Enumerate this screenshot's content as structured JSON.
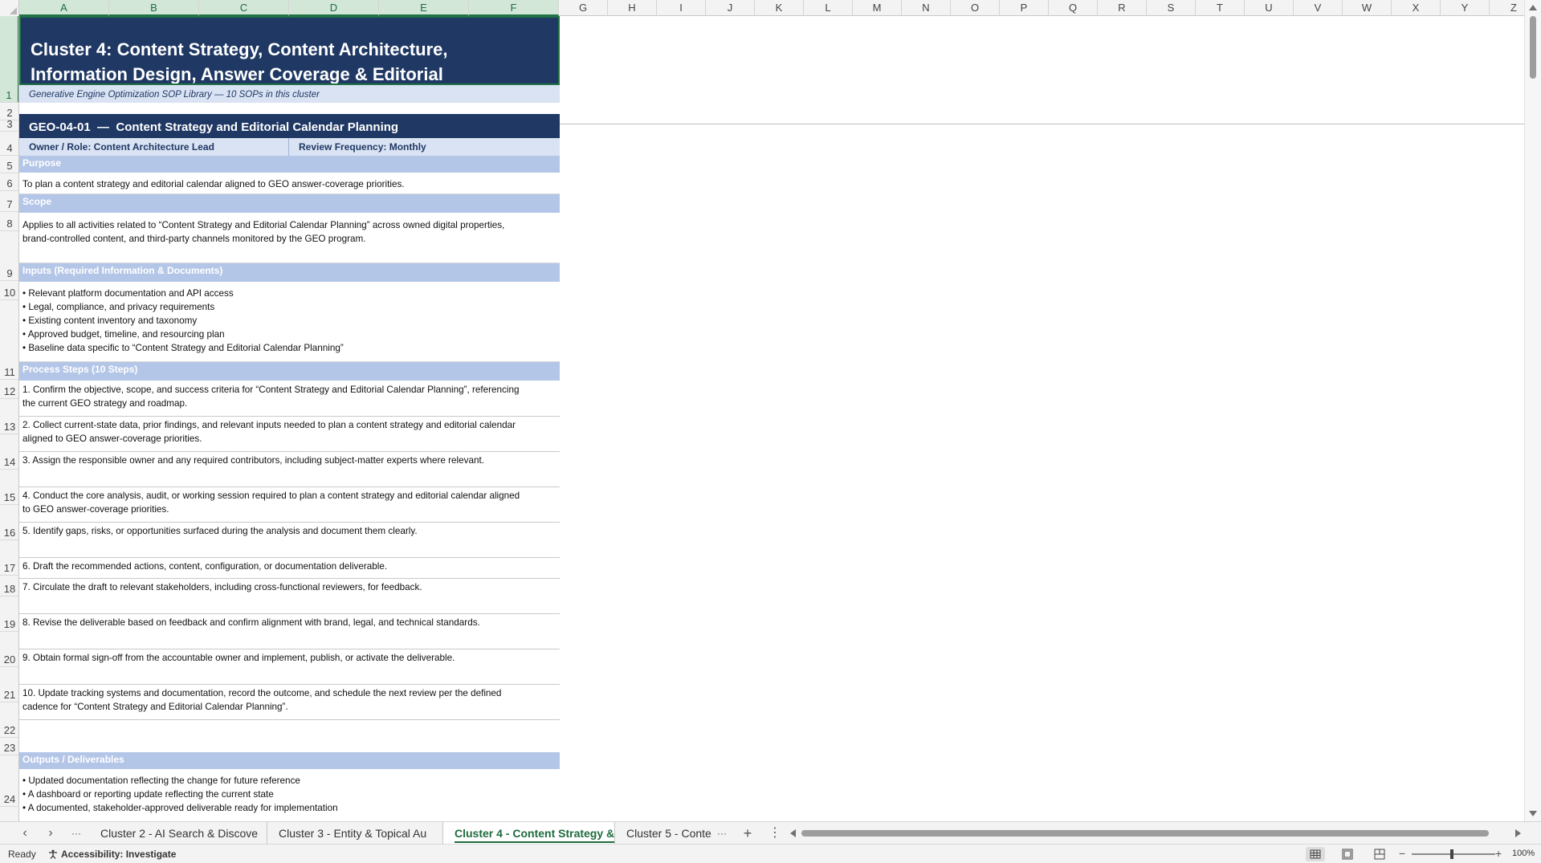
{
  "columns": [
    "A",
    "B",
    "C",
    "D",
    "E",
    "F",
    "G",
    "H",
    "I",
    "J",
    "K",
    "L",
    "M",
    "N",
    "O",
    "P",
    "Q",
    "R",
    "S",
    "T",
    "U",
    "V",
    "W",
    "X",
    "Y",
    "Z"
  ],
  "rows": [
    "1",
    "2",
    "3",
    "4",
    "5",
    "6",
    "7",
    "8",
    "9",
    "10",
    "11",
    "12",
    "13",
    "14",
    "15",
    "16",
    "17",
    "18",
    "19",
    "20",
    "21",
    "22",
    "23",
    "24"
  ],
  "sheet": {
    "title": "Cluster 4: Content Strategy, Content Architecture, Information Design, Answer Coverage & Editorial Optimization Management",
    "subtitle": "Generative Engine Optimization SOP Library — 10 SOPs in this cluster",
    "sop": {
      "header": "GEO-04-01  —  Content Strategy and Editorial Calendar Planning",
      "owner": "Owner / Role: Content Architecture Lead",
      "frequency": "Review Frequency: Monthly",
      "purpose_label": "Purpose",
      "purpose_text": "To plan a content strategy and editorial calendar aligned to GEO answer-coverage priorities.",
      "scope_label": "Scope",
      "scope_text_1": "Applies to all activities related to “Content Strategy and Editorial Calendar Planning” across owned digital properties,",
      "scope_text_2": "brand-controlled content, and third-party channels monitored by the GEO program.",
      "inputs_label": "Inputs (Required Information & Documents)",
      "inputs": [
        "• Relevant platform documentation and API access",
        "• Legal, compliance, and privacy requirements",
        "• Existing content inventory and taxonomy",
        "• Approved budget, timeline, and resourcing plan",
        "• Baseline data specific to “Content Strategy and Editorial Calendar Planning”"
      ],
      "steps_label": "Process Steps (10 Steps)",
      "steps": [
        [
          "1. Confirm the objective, scope, and success criteria for “Content Strategy and Editorial Calendar Planning”, referencing",
          "the current GEO strategy and roadmap."
        ],
        [
          "2. Collect current-state data, prior findings, and relevant inputs needed to plan a content strategy and editorial calendar",
          "aligned to GEO answer-coverage priorities."
        ],
        [
          "3. Assign the responsible owner and any required contributors, including subject-matter experts where relevant.",
          ""
        ],
        [
          "4. Conduct the core analysis, audit, or working session required to plan a content strategy and editorial calendar aligned",
          "to GEO answer-coverage priorities."
        ],
        [
          "5. Identify gaps, risks, or opportunities surfaced during the analysis and document them clearly.",
          ""
        ],
        [
          "6. Draft the recommended actions, content, configuration, or documentation deliverable.",
          ""
        ],
        [
          "7. Circulate the draft to relevant stakeholders, including cross-functional reviewers, for feedback.",
          ""
        ],
        [
          "8. Revise the deliverable based on feedback and confirm alignment with brand, legal, and technical standards.",
          ""
        ],
        [
          "9. Obtain formal sign-off from the accountable owner and implement, publish, or activate the deliverable.",
          ""
        ],
        [
          "10. Update tracking systems and documentation, record the outcome, and schedule the next review per the defined",
          "cadence for “Content Strategy and Editorial Calendar Planning”."
        ]
      ],
      "outputs_label": "Outputs / Deliverables",
      "outputs": [
        "• Updated documentation reflecting the change for future reference",
        "• A dashboard or reporting update reflecting the current state",
        "• A documented, stakeholder-approved deliverable ready for implementation"
      ]
    }
  },
  "tabs": {
    "prev": "‹",
    "next": "›",
    "more_left": "···",
    "items": [
      "Cluster 2 - AI Search & Discove",
      "Cluster 3 - Entity & Topical Au",
      "Cluster 4 - Content Strategy &",
      "Cluster 5 - Conte"
    ],
    "more_right": "···",
    "add": "+",
    "options": "⋮"
  },
  "status": {
    "ready": "Ready",
    "accessibility": "Accessibility: Investigate",
    "zoom": "100%",
    "zoom_minus": "−",
    "zoom_plus": "+"
  },
  "colors": {
    "header_navy": "#1f3864",
    "section_blue": "#b4c6e7",
    "light_blue": "#dae3f3",
    "excel_green": "#217346"
  }
}
